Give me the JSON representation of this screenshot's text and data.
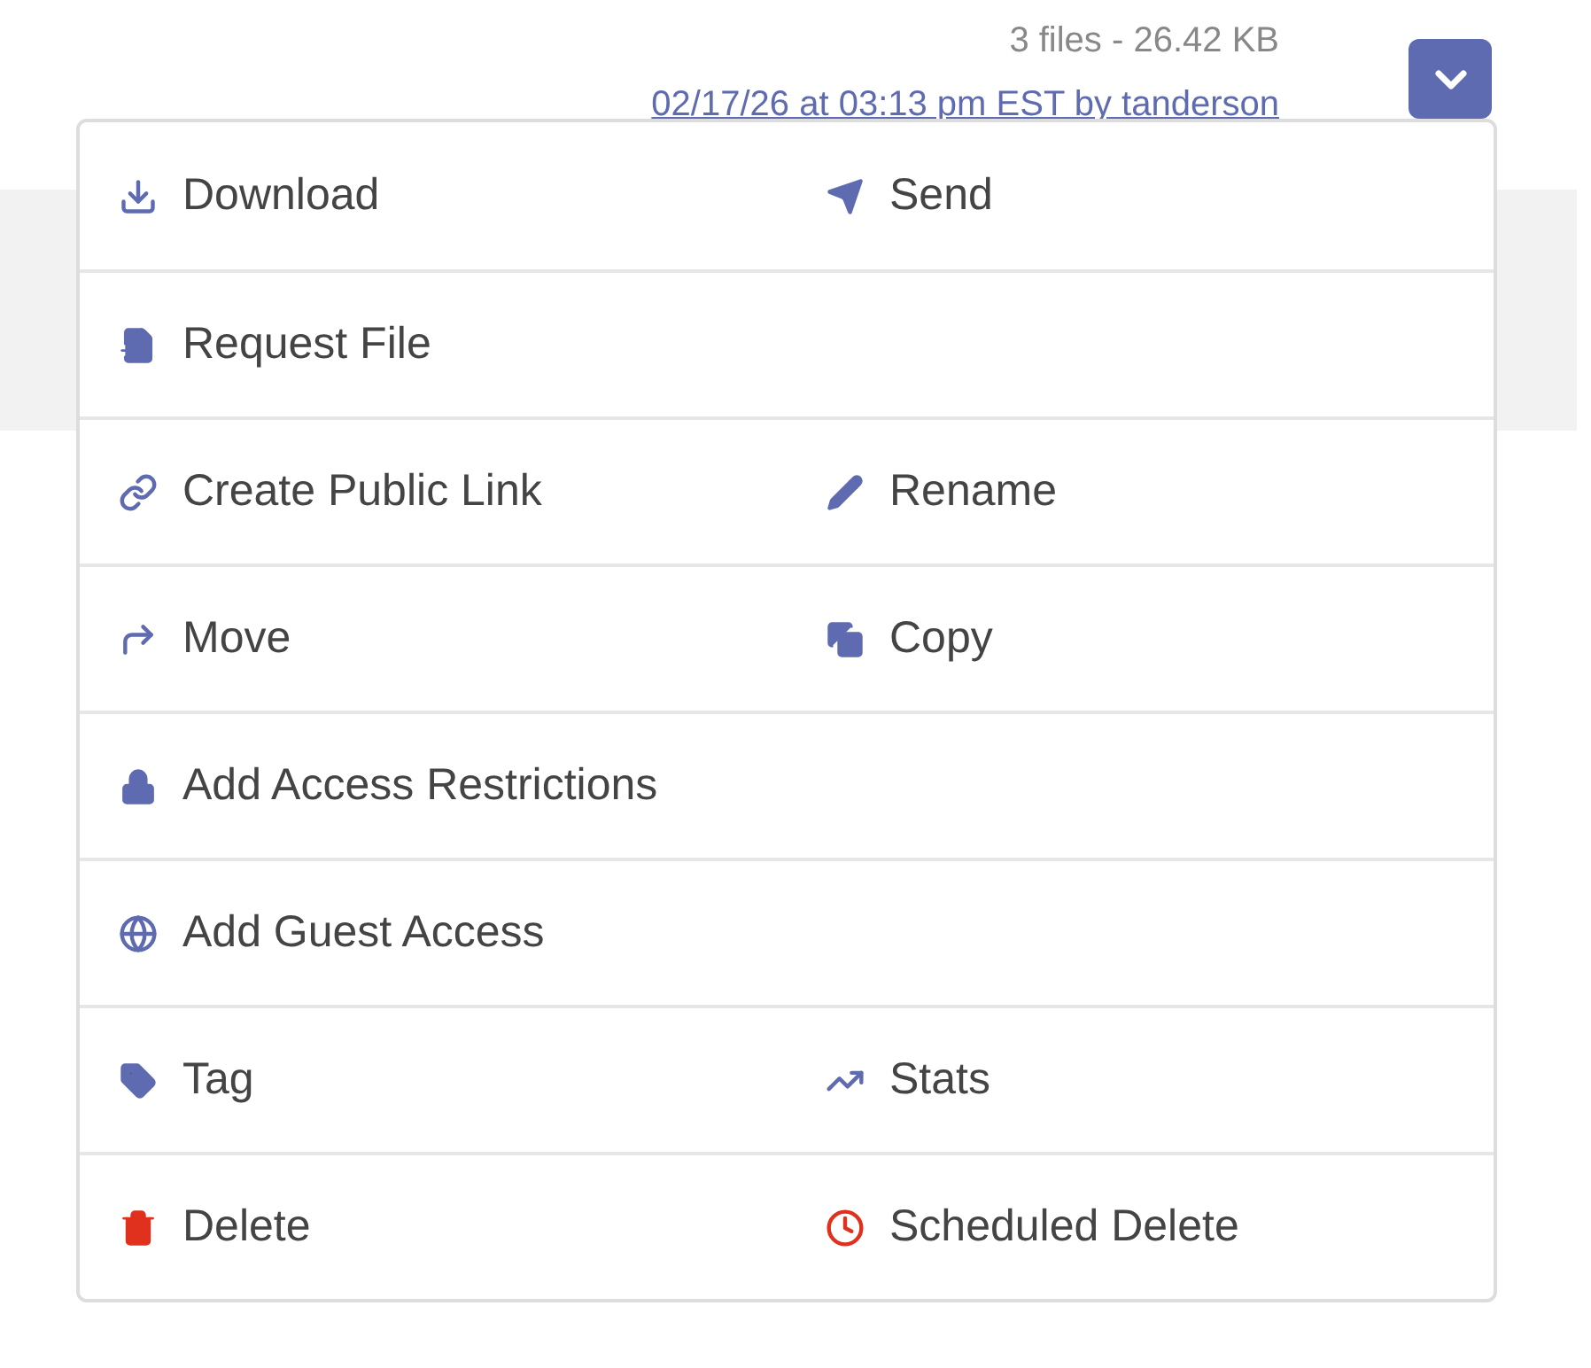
{
  "file_summary": "3 files - 26.42 KB",
  "uploaded_line": "02/17/26 at 03:13 pm EST by tanderson",
  "actions_menu": {
    "expanded": true,
    "rows": [
      {
        "items": [
          {
            "label": "Download",
            "kind": "download",
            "color": "#5f6bb0"
          },
          {
            "label": "Send",
            "kind": "send",
            "color": "#5f6bb0"
          }
        ]
      },
      {
        "items": [
          {
            "label": "Request File",
            "kind": "file",
            "color": "#5f6bb0"
          }
        ]
      },
      {
        "items": [
          {
            "label": "Create Public Link",
            "kind": "link",
            "color": "#5f6bb0"
          },
          {
            "label": "Rename",
            "kind": "pencil",
            "color": "#5f6bb0"
          }
        ]
      },
      {
        "items": [
          {
            "label": "Move",
            "kind": "move",
            "color": "#5f6bb0"
          },
          {
            "label": "Copy",
            "kind": "copy",
            "color": "#5f6bb0"
          }
        ]
      },
      {
        "items": [
          {
            "label": "Add Access Restrictions",
            "kind": "lock",
            "color": "#5f6bb0"
          }
        ]
      },
      {
        "items": [
          {
            "label": "Add Guest Access",
            "kind": "globe",
            "color": "#5f6bb0"
          }
        ]
      },
      {
        "items": [
          {
            "label": "Tag",
            "kind": "tag",
            "color": "#5f6bb0"
          },
          {
            "label": "Stats",
            "kind": "stats",
            "color": "#5f6bb0"
          }
        ]
      },
      {
        "items": [
          {
            "label": "Delete",
            "kind": "trash",
            "color": "#e0301e"
          },
          {
            "label": "Scheduled Delete",
            "kind": "clock",
            "color": "#e0301e"
          }
        ]
      }
    ]
  }
}
